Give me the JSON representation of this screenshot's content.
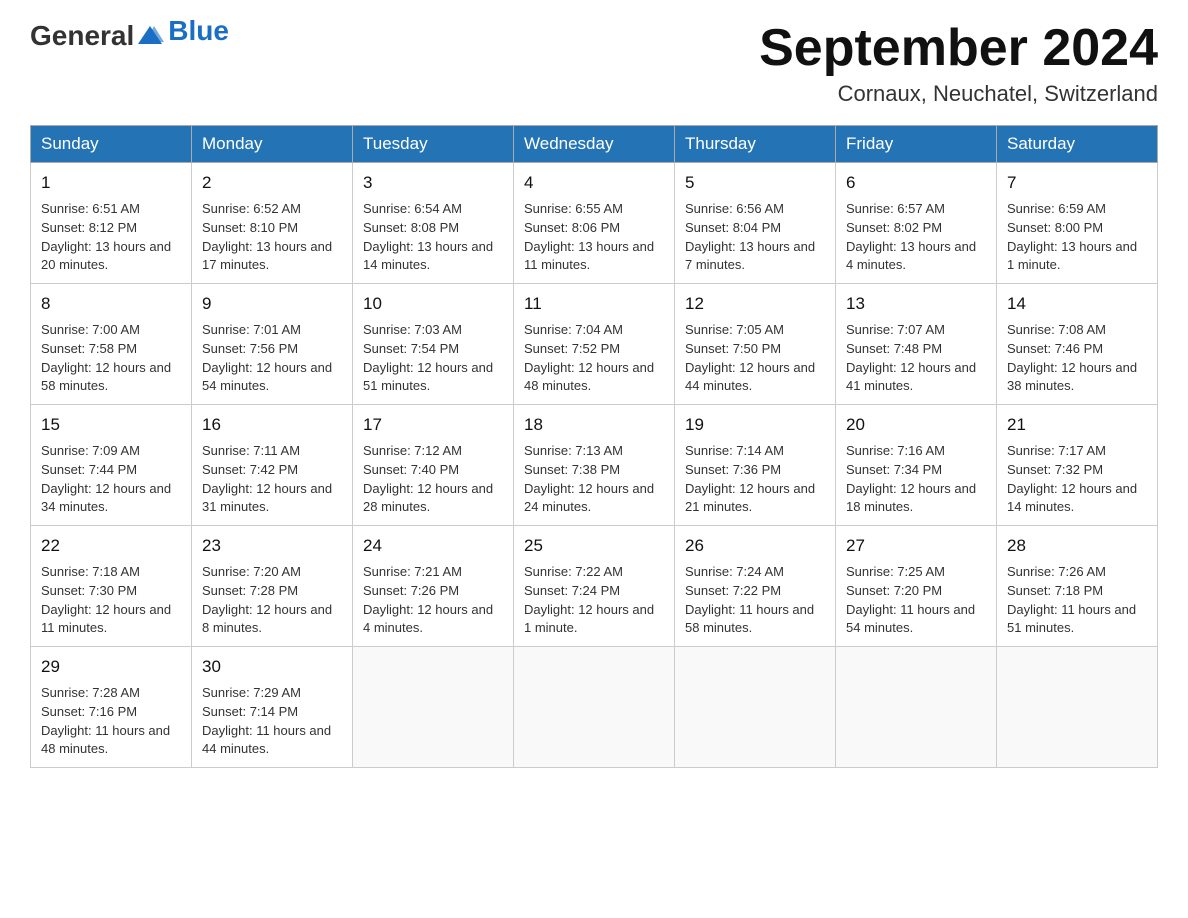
{
  "header": {
    "logo_general": "General",
    "logo_blue": "Blue",
    "month_title": "September 2024",
    "location": "Cornaux, Neuchatel, Switzerland"
  },
  "days_of_week": [
    "Sunday",
    "Monday",
    "Tuesday",
    "Wednesday",
    "Thursday",
    "Friday",
    "Saturday"
  ],
  "weeks": [
    [
      {
        "day": "1",
        "sunrise": "6:51 AM",
        "sunset": "8:12 PM",
        "daylight": "13 hours and 20 minutes."
      },
      {
        "day": "2",
        "sunrise": "6:52 AM",
        "sunset": "8:10 PM",
        "daylight": "13 hours and 17 minutes."
      },
      {
        "day": "3",
        "sunrise": "6:54 AM",
        "sunset": "8:08 PM",
        "daylight": "13 hours and 14 minutes."
      },
      {
        "day": "4",
        "sunrise": "6:55 AM",
        "sunset": "8:06 PM",
        "daylight": "13 hours and 11 minutes."
      },
      {
        "day": "5",
        "sunrise": "6:56 AM",
        "sunset": "8:04 PM",
        "daylight": "13 hours and 7 minutes."
      },
      {
        "day": "6",
        "sunrise": "6:57 AM",
        "sunset": "8:02 PM",
        "daylight": "13 hours and 4 minutes."
      },
      {
        "day": "7",
        "sunrise": "6:59 AM",
        "sunset": "8:00 PM",
        "daylight": "13 hours and 1 minute."
      }
    ],
    [
      {
        "day": "8",
        "sunrise": "7:00 AM",
        "sunset": "7:58 PM",
        "daylight": "12 hours and 58 minutes."
      },
      {
        "day": "9",
        "sunrise": "7:01 AM",
        "sunset": "7:56 PM",
        "daylight": "12 hours and 54 minutes."
      },
      {
        "day": "10",
        "sunrise": "7:03 AM",
        "sunset": "7:54 PM",
        "daylight": "12 hours and 51 minutes."
      },
      {
        "day": "11",
        "sunrise": "7:04 AM",
        "sunset": "7:52 PM",
        "daylight": "12 hours and 48 minutes."
      },
      {
        "day": "12",
        "sunrise": "7:05 AM",
        "sunset": "7:50 PM",
        "daylight": "12 hours and 44 minutes."
      },
      {
        "day": "13",
        "sunrise": "7:07 AM",
        "sunset": "7:48 PM",
        "daylight": "12 hours and 41 minutes."
      },
      {
        "day": "14",
        "sunrise": "7:08 AM",
        "sunset": "7:46 PM",
        "daylight": "12 hours and 38 minutes."
      }
    ],
    [
      {
        "day": "15",
        "sunrise": "7:09 AM",
        "sunset": "7:44 PM",
        "daylight": "12 hours and 34 minutes."
      },
      {
        "day": "16",
        "sunrise": "7:11 AM",
        "sunset": "7:42 PM",
        "daylight": "12 hours and 31 minutes."
      },
      {
        "day": "17",
        "sunrise": "7:12 AM",
        "sunset": "7:40 PM",
        "daylight": "12 hours and 28 minutes."
      },
      {
        "day": "18",
        "sunrise": "7:13 AM",
        "sunset": "7:38 PM",
        "daylight": "12 hours and 24 minutes."
      },
      {
        "day": "19",
        "sunrise": "7:14 AM",
        "sunset": "7:36 PM",
        "daylight": "12 hours and 21 minutes."
      },
      {
        "day": "20",
        "sunrise": "7:16 AM",
        "sunset": "7:34 PM",
        "daylight": "12 hours and 18 minutes."
      },
      {
        "day": "21",
        "sunrise": "7:17 AM",
        "sunset": "7:32 PM",
        "daylight": "12 hours and 14 minutes."
      }
    ],
    [
      {
        "day": "22",
        "sunrise": "7:18 AM",
        "sunset": "7:30 PM",
        "daylight": "12 hours and 11 minutes."
      },
      {
        "day": "23",
        "sunrise": "7:20 AM",
        "sunset": "7:28 PM",
        "daylight": "12 hours and 8 minutes."
      },
      {
        "day": "24",
        "sunrise": "7:21 AM",
        "sunset": "7:26 PM",
        "daylight": "12 hours and 4 minutes."
      },
      {
        "day": "25",
        "sunrise": "7:22 AM",
        "sunset": "7:24 PM",
        "daylight": "12 hours and 1 minute."
      },
      {
        "day": "26",
        "sunrise": "7:24 AM",
        "sunset": "7:22 PM",
        "daylight": "11 hours and 58 minutes."
      },
      {
        "day": "27",
        "sunrise": "7:25 AM",
        "sunset": "7:20 PM",
        "daylight": "11 hours and 54 minutes."
      },
      {
        "day": "28",
        "sunrise": "7:26 AM",
        "sunset": "7:18 PM",
        "daylight": "11 hours and 51 minutes."
      }
    ],
    [
      {
        "day": "29",
        "sunrise": "7:28 AM",
        "sunset": "7:16 PM",
        "daylight": "11 hours and 48 minutes."
      },
      {
        "day": "30",
        "sunrise": "7:29 AM",
        "sunset": "7:14 PM",
        "daylight": "11 hours and 44 minutes."
      },
      null,
      null,
      null,
      null,
      null
    ]
  ]
}
